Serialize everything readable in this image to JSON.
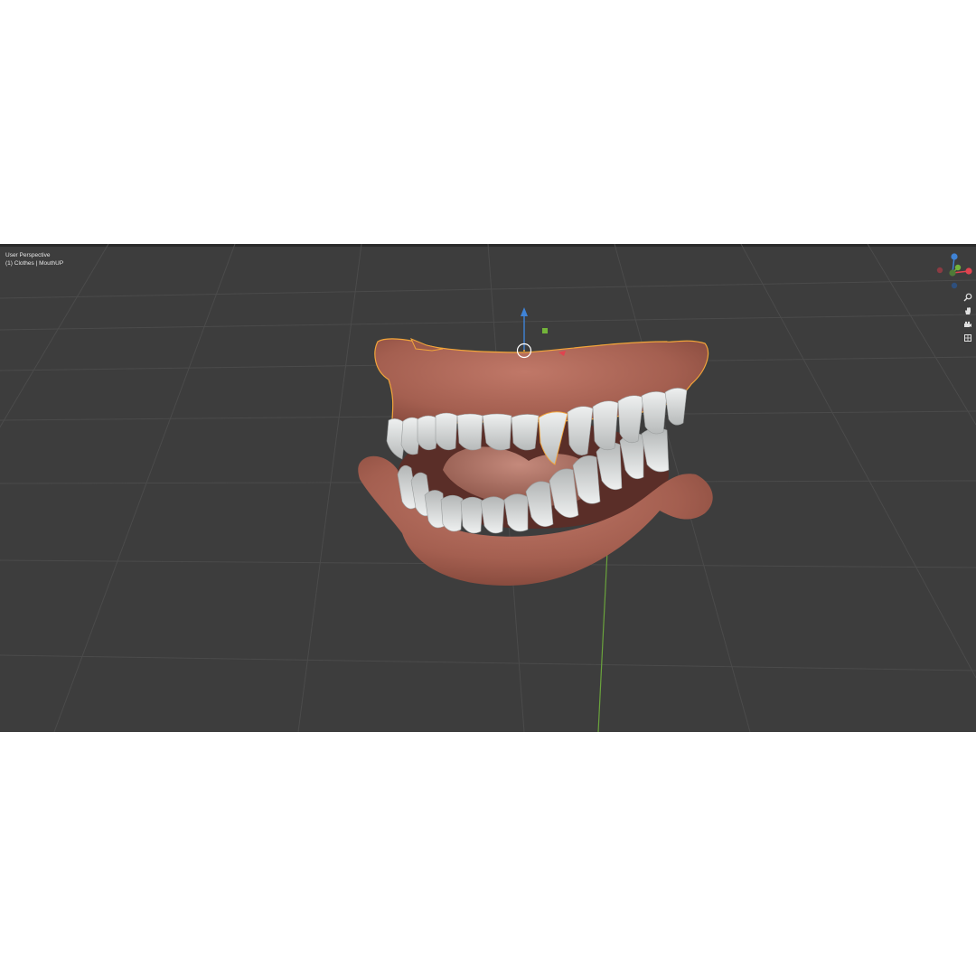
{
  "viewport": {
    "view_name": "User Perspective",
    "collection_info": "(1) Clothes | MouthUP"
  },
  "gizmo": {
    "axes": [
      {
        "name": "X",
        "color": "#e0434f"
      },
      {
        "name": "Y",
        "color": "#73b43a"
      },
      {
        "name": "Z",
        "color": "#3f83d6"
      }
    ]
  },
  "nav_tools": [
    {
      "name": "zoom-icon",
      "glyph": "⚲"
    },
    {
      "name": "hand-icon",
      "glyph": "✋"
    },
    {
      "name": "camera-icon",
      "glyph": "▣"
    },
    {
      "name": "grid-icon",
      "glyph": "▦"
    }
  ],
  "colors": {
    "background": "#3d3d3d",
    "grid": "#4a4a4a",
    "gum": "#a86353",
    "teeth": "#d7d9d9",
    "selection_outline": "#f2a53a"
  }
}
